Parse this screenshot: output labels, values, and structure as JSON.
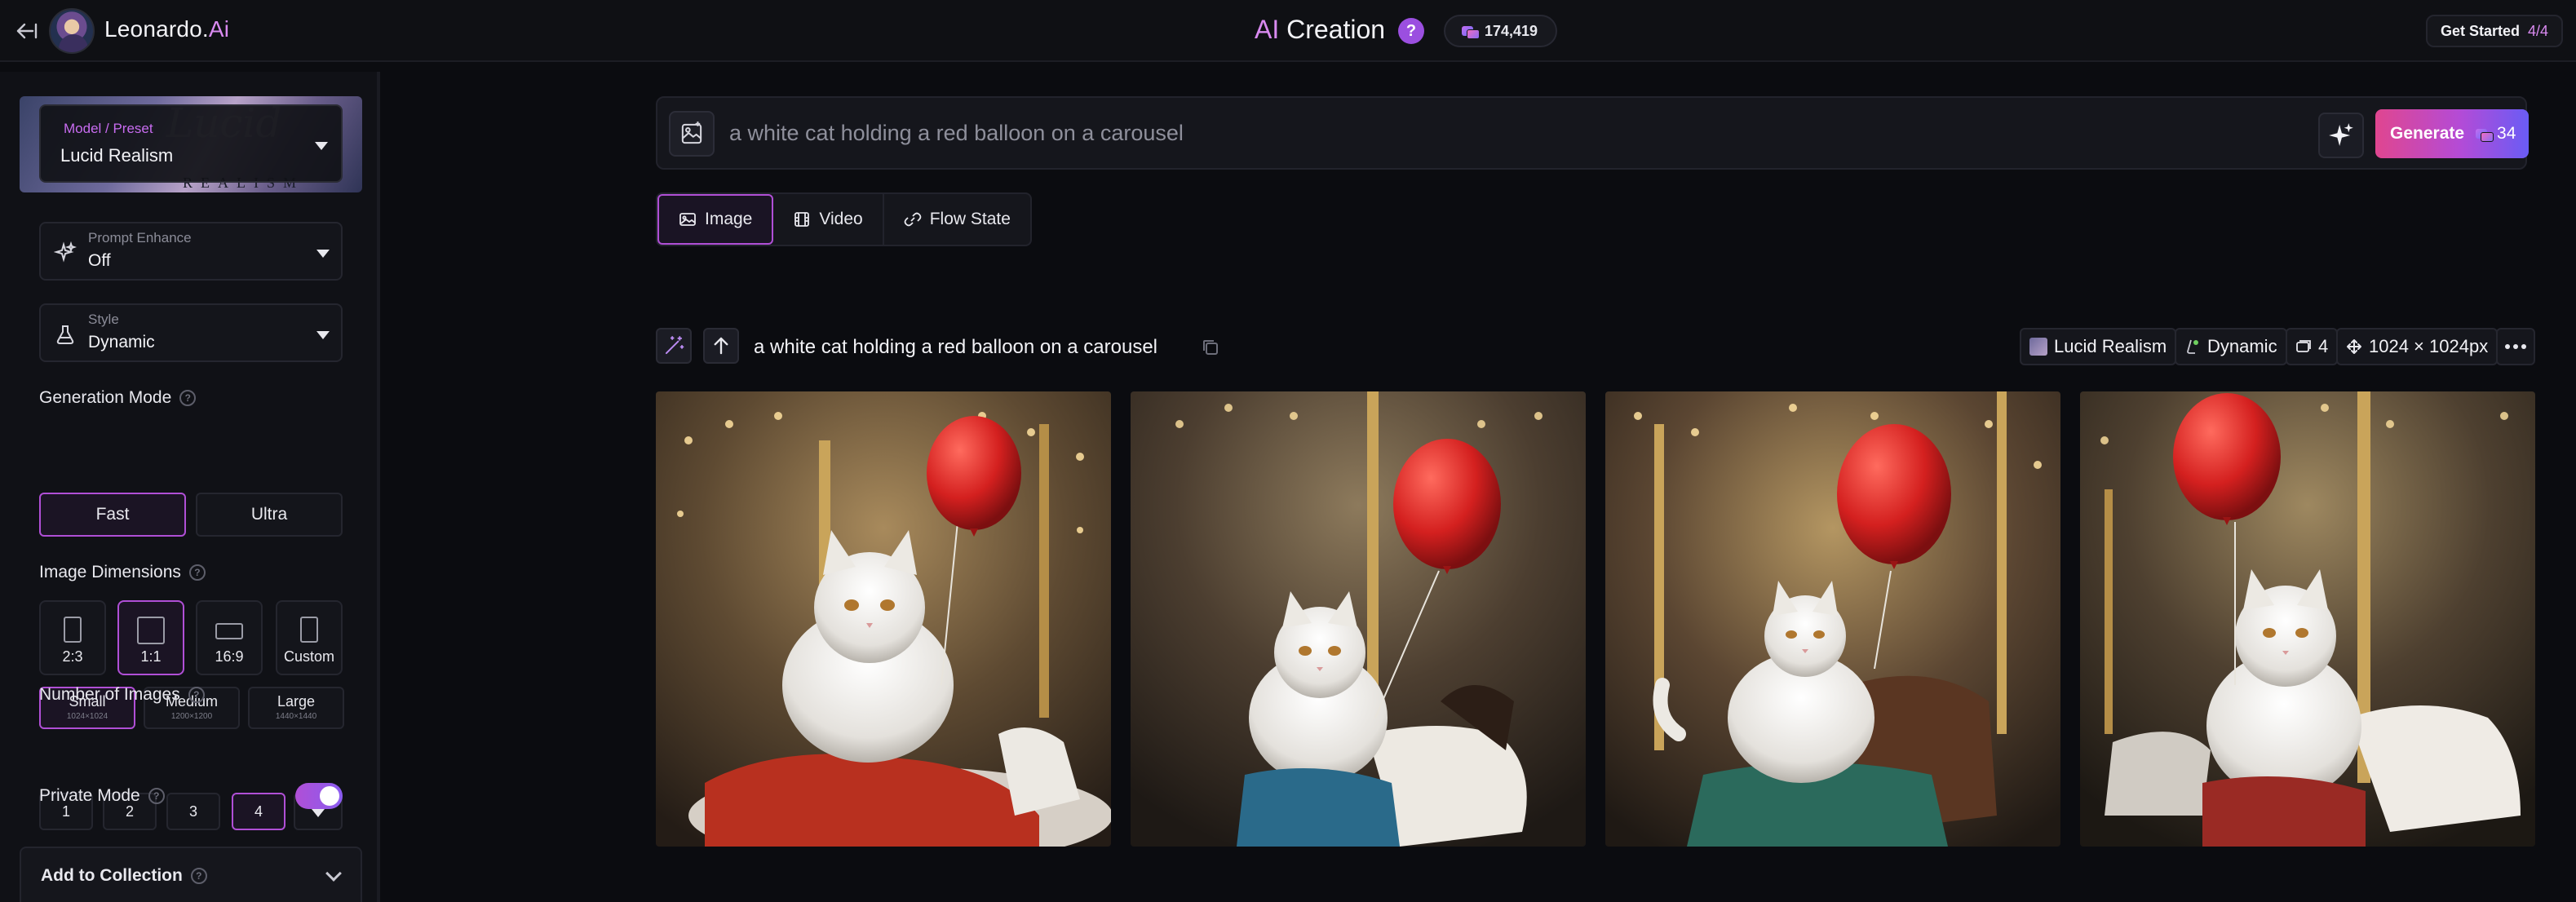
{
  "app": {
    "name": "Leonardo.",
    "name_accent": "Ai"
  },
  "header": {
    "title_accent": "AI",
    "title_rest": " Creation",
    "help": "?",
    "tokens": "174,419",
    "get_started": "Get Started",
    "get_started_progress": "4/4"
  },
  "sidebar": {
    "model": {
      "label": "Model / Preset",
      "value": "Lucid Realism",
      "card_wordmark": "REALISM"
    },
    "prompt_enhance": {
      "label": "Prompt Enhance",
      "value": "Off"
    },
    "style": {
      "label": "Style",
      "value": "Dynamic"
    },
    "generation_mode": {
      "title": "Generation Mode",
      "options": [
        "Fast",
        "Ultra"
      ],
      "selected": "Fast"
    },
    "image_dimensions": {
      "title": "Image Dimensions",
      "ratios": [
        "2:3",
        "1:1",
        "16:9",
        "Custom"
      ],
      "selected_ratio": "1:1",
      "sizes": [
        {
          "label": "Small",
          "sub": "1024×1024"
        },
        {
          "label": "Medium",
          "sub": "1200×1200"
        },
        {
          "label": "Large",
          "sub": "1440×1440"
        }
      ],
      "selected_size": "Small"
    },
    "number_of_images": {
      "title": "Number of Images",
      "options": [
        "1",
        "2",
        "3",
        "4"
      ],
      "selected": "4"
    },
    "private_mode": {
      "title": "Private Mode",
      "enabled": true
    },
    "add_to_collection": {
      "title": "Add to Collection"
    }
  },
  "prompt": {
    "placeholder": "a white cat holding a red balloon on a carousel"
  },
  "generate": {
    "label": "Generate",
    "cost": "34"
  },
  "tabs": [
    {
      "label": "Image",
      "icon": "image-icon"
    },
    {
      "label": "Video",
      "icon": "video-icon"
    },
    {
      "label": "Flow State",
      "icon": "flow-icon"
    }
  ],
  "generation": {
    "prompt": "a white cat holding a red balloon on a carousel",
    "model": "Lucid Realism",
    "style": "Dynamic",
    "count": "4",
    "dimensions": "1024 × 1024px"
  },
  "colors": {
    "accent": "#b04fd6",
    "balloon": "#d4201f",
    "generate_start": "#e0468f",
    "generate_end": "#6a5cf5"
  }
}
